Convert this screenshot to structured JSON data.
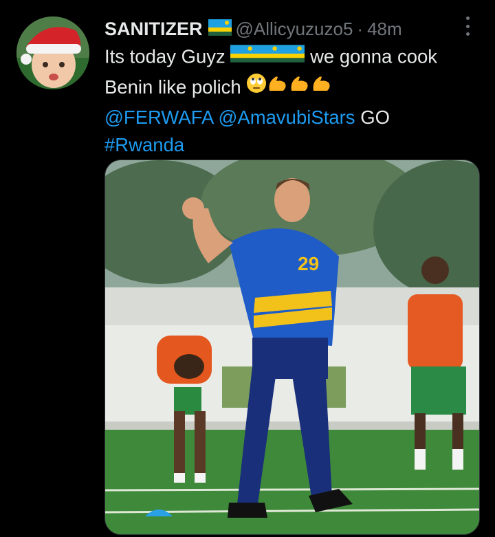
{
  "tweet": {
    "author_name": "SANITIZER",
    "handle": "@Allicyuzuzo5",
    "separator": "·",
    "time": "48m",
    "text_part1": "Its today  Guyz",
    "text_part2": "we gonna cook",
    "text_line2": "Benin like polich",
    "mention1": "@FERWAFA",
    "mention2": "@AmavubiStars",
    "text_go": "GO",
    "hashtag": "#Rwanda",
    "jersey_number": "29"
  },
  "icons": {
    "more": "more-options-icon",
    "flag": "rwanda-flag-emoji",
    "eyeroll": "rolling-eyes-emoji",
    "flex": "flexed-biceps-emoji"
  },
  "colors": {
    "background": "#000000",
    "text": "#e7e9ea",
    "secondary": "#71767b",
    "link": "#1d9bf0"
  }
}
